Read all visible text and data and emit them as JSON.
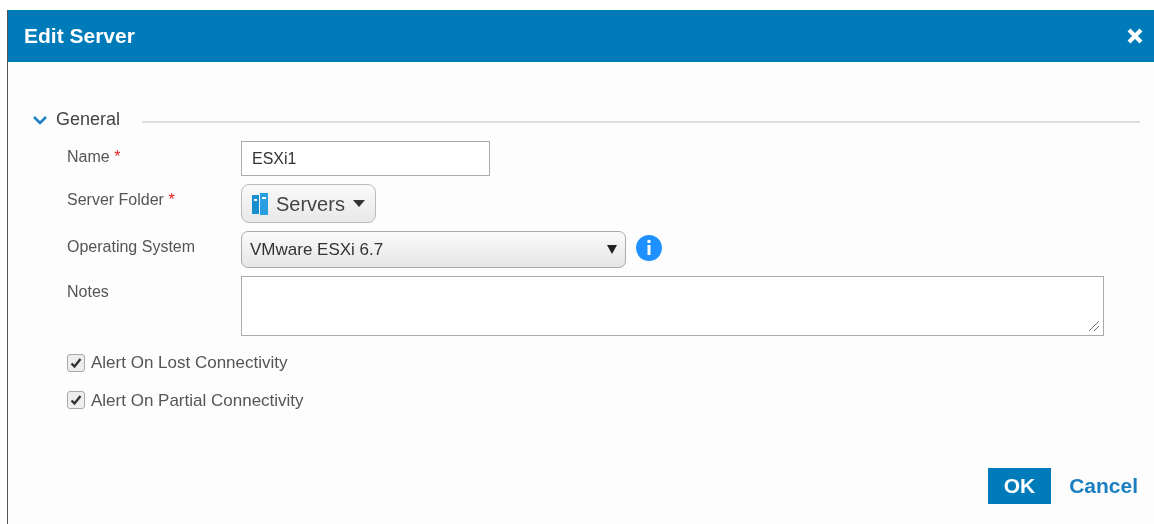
{
  "window": {
    "title": "Edit Server"
  },
  "section": {
    "title": "General",
    "expanded": true
  },
  "fields": [
    {
      "kind": "text",
      "label": "Name",
      "required_mark": "*",
      "value": "ESXi1"
    },
    {
      "kind": "folder",
      "label": "Server Folder",
      "required_mark": "*",
      "value": "Servers"
    },
    {
      "kind": "select",
      "label": "Operating System",
      "value": "VMware ESXi 6.7"
    },
    {
      "kind": "textarea",
      "label": "Notes"
    }
  ],
  "checkboxes": [
    {
      "label": "Alert On Lost Connectivity",
      "checked": true
    },
    {
      "label": "Alert On Partial Connectivity",
      "checked": true
    }
  ],
  "buttons": [
    {
      "kind": "primary",
      "label": "OK"
    },
    {
      "kind": "link",
      "label": "Cancel"
    }
  ]
}
